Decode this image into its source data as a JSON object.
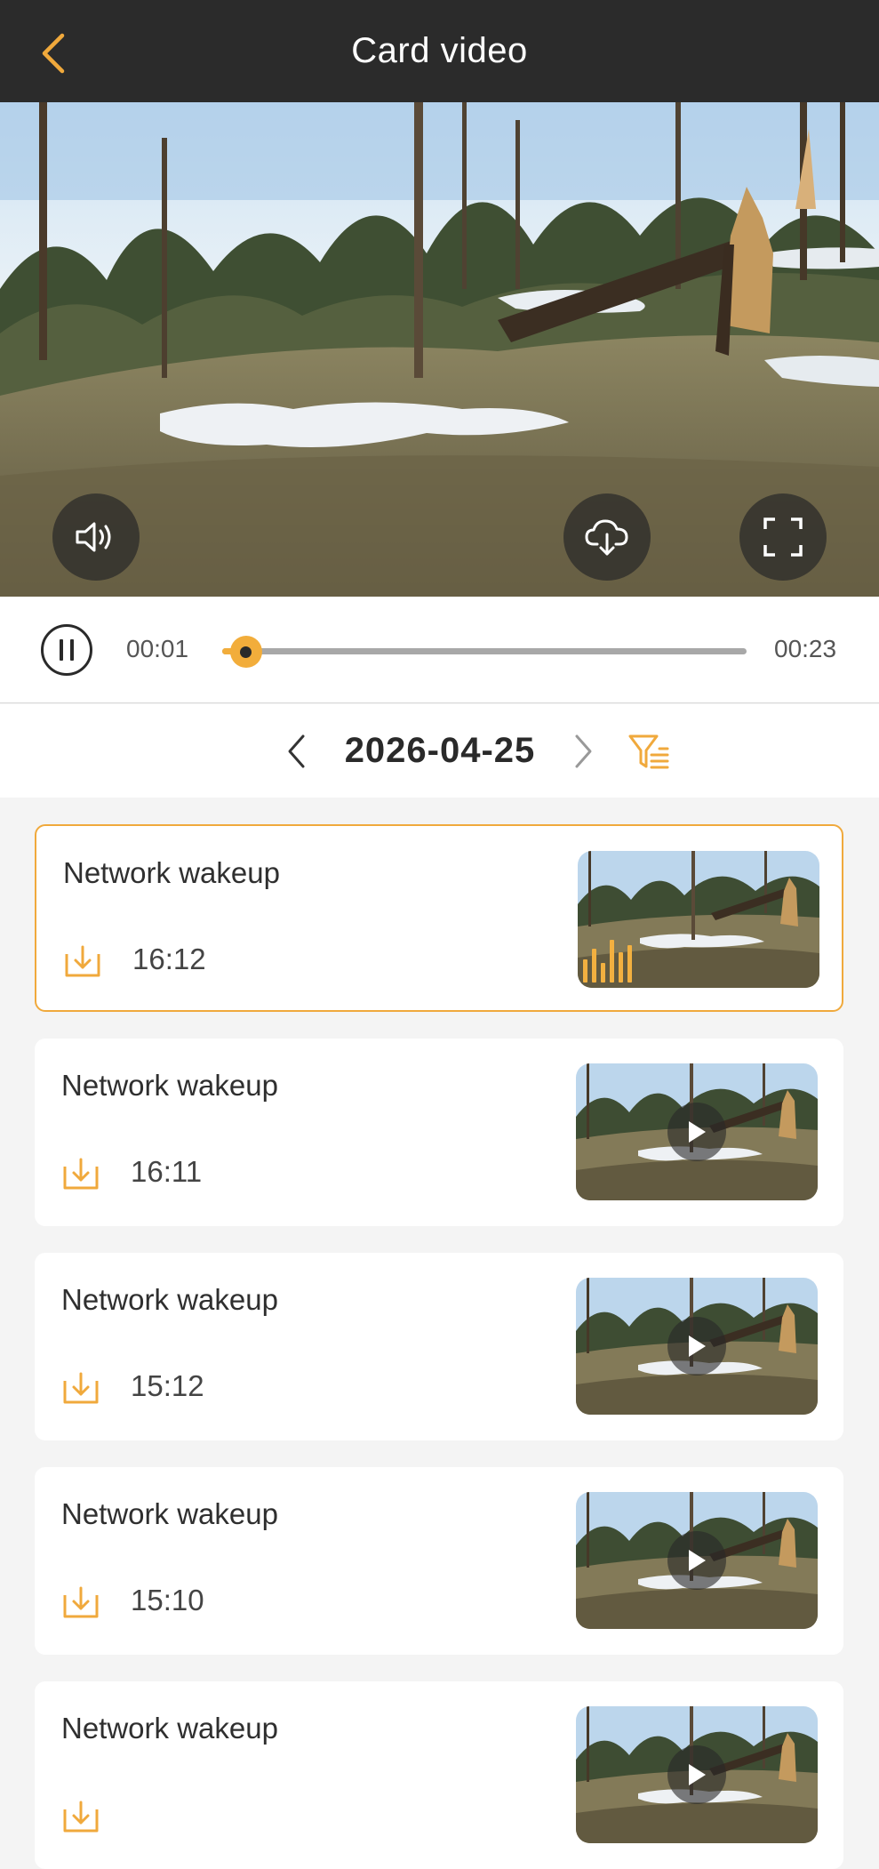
{
  "header": {
    "title": "Card video"
  },
  "player": {
    "current_time": "00:01",
    "duration": "00:23",
    "progress_fraction": 0.045
  },
  "date_nav": {
    "date": "2026-04-25"
  },
  "accent_color": "#f0a93c",
  "icons": {
    "back": "chevron-left-icon",
    "sound": "speaker-icon",
    "download_cloud": "cloud-download-icon",
    "fullscreen": "fullscreen-icon",
    "filter": "filter-list-icon",
    "item_download": "download-tray-icon",
    "play": "play-icon"
  },
  "recordings": [
    {
      "title": "Network wakeup",
      "time": "16:12",
      "selected": true
    },
    {
      "title": "Network wakeup",
      "time": "16:11",
      "selected": false
    },
    {
      "title": "Network wakeup",
      "time": "15:12",
      "selected": false
    },
    {
      "title": "Network wakeup",
      "time": "15:10",
      "selected": false
    },
    {
      "title": "Network wakeup",
      "time": "",
      "selected": false
    }
  ]
}
